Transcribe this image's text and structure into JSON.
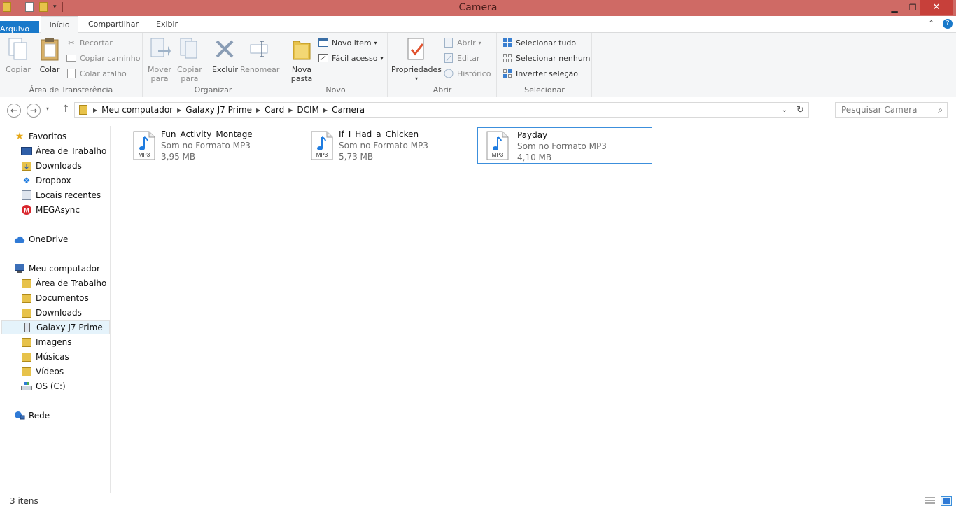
{
  "window": {
    "title": "Camera"
  },
  "tabs": [
    {
      "label": "Arquivo"
    },
    {
      "label": "Início"
    },
    {
      "label": "Compartilhar"
    },
    {
      "label": "Exibir"
    }
  ],
  "ribbon": {
    "clipboard": {
      "copy": "Copiar",
      "paste": "Colar",
      "cut": "Recortar",
      "copy_path": "Copiar caminho",
      "paste_shortcut": "Colar atalho",
      "label": "Área de Transferência"
    },
    "organize": {
      "move_to_1": "Mover",
      "move_to_2": "para",
      "copy_to_1": "Copiar",
      "copy_to_2": "para",
      "delete": "Excluir",
      "rename": "Renomear",
      "label": "Organizar"
    },
    "new": {
      "new_folder_1": "Nova",
      "new_folder_2": "pasta",
      "new_item": "Novo item",
      "easy_access": "Fácil acesso",
      "label": "Novo"
    },
    "open": {
      "properties": "Propriedades",
      "open": "Abrir",
      "edit": "Editar",
      "history": "Histórico",
      "label": "Abrir"
    },
    "select": {
      "select_all": "Selecionar tudo",
      "select_none": "Selecionar nenhum",
      "invert": "Inverter seleção",
      "label": "Selecionar"
    }
  },
  "address": {
    "crumbs": [
      "Meu computador",
      "Galaxy J7 Prime",
      "Card",
      "DCIM",
      "Camera"
    ],
    "search_placeholder": "Pesquisar Camera"
  },
  "nav": {
    "favorites": "Favoritos",
    "fav_items": [
      "Área de Trabalho",
      "Downloads",
      "Dropbox",
      "Locais recentes",
      "MEGAsync"
    ],
    "onedrive": "OneDrive",
    "computer": "Meu computador",
    "computer_items": [
      "Área de Trabalho",
      "Documentos",
      "Downloads",
      "Galaxy J7 Prime",
      "Imagens",
      "Músicas",
      "Vídeos",
      "OS (C:)"
    ],
    "network": "Rede"
  },
  "files": [
    {
      "name": "Fun_Activity_Montage",
      "type": "Som no Formato MP3",
      "size": "3,95 MB",
      "icon_label": "MP3"
    },
    {
      "name": "If_I_Had_a_Chicken",
      "type": "Som no Formato MP3",
      "size": "5,73 MB",
      "icon_label": "MP3"
    },
    {
      "name": "Payday",
      "type": "Som no Formato MP3",
      "size": "4,10 MB",
      "icon_label": "MP3"
    }
  ],
  "status": {
    "count": "3 itens"
  },
  "colors": {
    "titlebar": "#cf6a65",
    "file_tab": "#1979ca",
    "selection": "#3c8fdc"
  }
}
